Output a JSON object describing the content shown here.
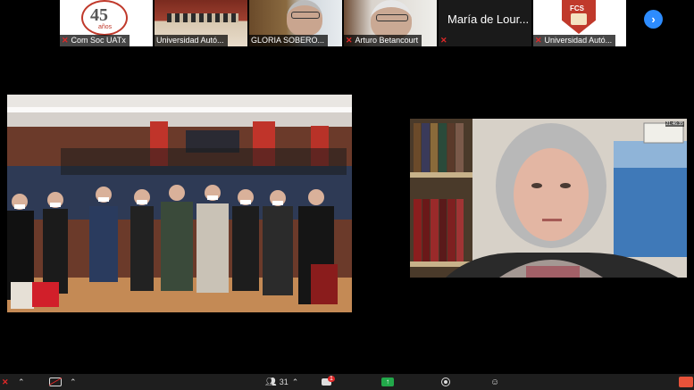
{
  "participants": [
    {
      "name": "Com Soc UATx",
      "logo_text": "45",
      "logo_sub": "años"
    },
    {
      "name": "Universidad Autó..."
    },
    {
      "name": "GLORIA SOBERO..."
    },
    {
      "name": "Arturo Betancourt"
    },
    {
      "name": "María de Lour...",
      "is_text_tile": true
    },
    {
      "name": "Universidad Autó...",
      "logo_text": "FCS"
    }
  ],
  "speaker": {
    "timestamp": "21:46:35"
  },
  "toolbar": {
    "participants_count": "31",
    "chat_badge": "1"
  },
  "colors": {
    "accent": "#2d8cff",
    "muted": "#e02828",
    "share": "#22a84a",
    "end": "#e8533a"
  }
}
